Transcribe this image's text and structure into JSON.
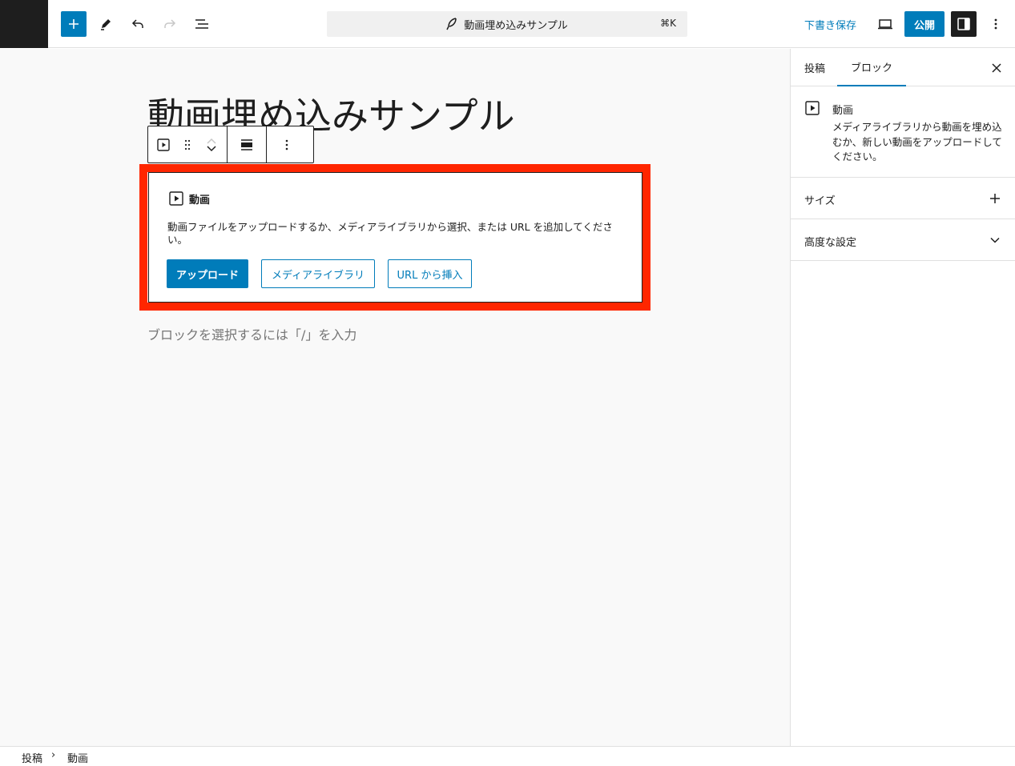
{
  "topbar": {
    "post_title_command": "動画埋め込みサンプル",
    "command_shortcut": "⌘K",
    "save_draft_label": "下書き保存",
    "publish_label": "公開"
  },
  "editor": {
    "post_title": "動画埋め込みサンプル",
    "video_block": {
      "label": "動画",
      "instructions": "動画ファイルをアップロードするか、メディアライブラリから選択、または URL を追加してください。",
      "upload_label": "アップロード",
      "media_library_label": "メディアライブラリ",
      "insert_url_label": "URL から挿入"
    },
    "append_hint": "ブロックを選択するには「/」を入力"
  },
  "sidebar": {
    "tab_post": "投稿",
    "tab_block": "ブロック",
    "block_card": {
      "title": "動画",
      "description": "メディアライブラリから動画を埋め込むか、新しい動画をアップロードしてください。"
    },
    "panels": [
      {
        "label": "サイズ"
      },
      {
        "label": "高度な設定"
      }
    ]
  },
  "breadcrumb": {
    "items": [
      "投稿",
      "動画"
    ],
    "separator": "›"
  },
  "colors": {
    "accent": "#007cba",
    "highlight_frame": "#ff2600",
    "dark": "#1e1e1e"
  }
}
